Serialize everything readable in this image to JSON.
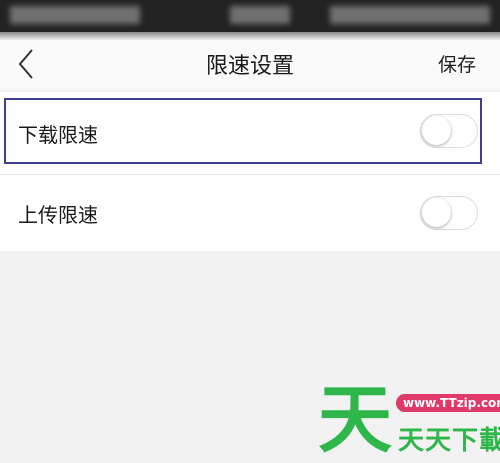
{
  "header": {
    "title": "限速设置",
    "save_label": "保存",
    "back_icon": "chevron-left-icon"
  },
  "settings": [
    {
      "label": "下载限速",
      "enabled": false,
      "highlighted": true
    },
    {
      "label": "上传限速",
      "enabled": false,
      "highlighted": false
    }
  ],
  "watermark": {
    "big_char": "天",
    "url": "www.TTzip.com",
    "text": "天天下載"
  },
  "colors": {
    "highlight_border": "#3d3f8e",
    "watermark_green": "#2fb64a",
    "watermark_pink": "#e03a6a"
  }
}
